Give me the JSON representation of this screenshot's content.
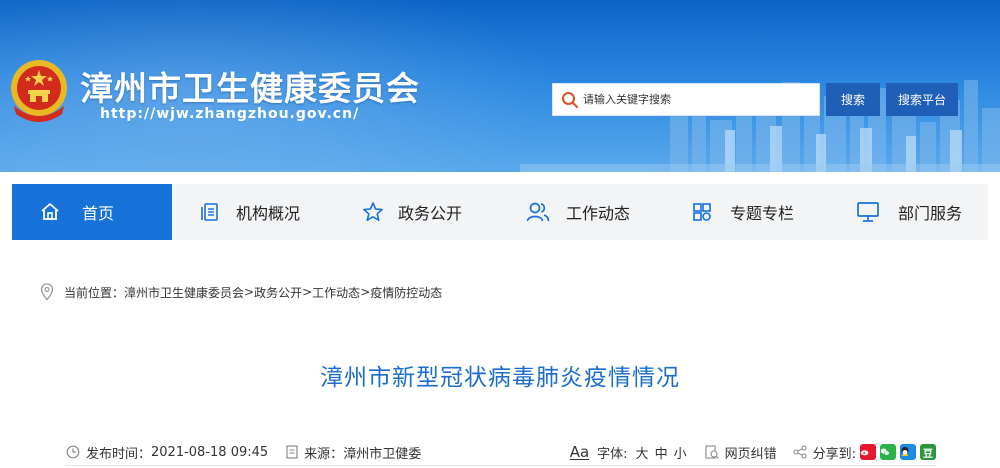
{
  "header": {
    "site_title": "漳州市卫生健康委员会",
    "site_url": "http://wjw.zhangzhou.gov.cn/",
    "emblem_icon": "national-emblem-icon",
    "search": {
      "placeholder": "请输入关键字搜索"
    },
    "search_button": "搜索",
    "platform_button": "搜索平台"
  },
  "nav": {
    "items": [
      {
        "label": "首页",
        "icon": "home-icon",
        "active": true
      },
      {
        "label": "机构概况",
        "icon": "document-icon",
        "active": false
      },
      {
        "label": "政务公开",
        "icon": "star-icon",
        "active": false
      },
      {
        "label": "工作动态",
        "icon": "people-icon",
        "active": false
      },
      {
        "label": "专题专栏",
        "icon": "grid-icon",
        "active": false
      },
      {
        "label": "部门服务",
        "icon": "monitor-icon",
        "active": false
      }
    ]
  },
  "breadcrumb": {
    "prefix": "当前位置：",
    "items": [
      "漳州市卫生健康委员会",
      "政务公开",
      "工作动态",
      "疫情防控动态"
    ],
    "separator": ">"
  },
  "article": {
    "title": "漳州市新型冠状病毒肺炎疫情情况",
    "publish_label": "发布时间：",
    "publish_time": "2021-08-18 09:45",
    "source_label": "来源：",
    "source": "漳州市卫健委",
    "font_label": "字体:",
    "font_icon": "Aa",
    "font_large": "大",
    "font_medium": "中",
    "font_small": "小",
    "error_label": "网页纠错",
    "share_label": "分享到:",
    "share_targets": [
      "weibo-icon",
      "wechat-icon",
      "qq-icon",
      "douban-icon"
    ],
    "share_douban_glyph": "豆"
  },
  "colors": {
    "banner_top": "#0b63c6",
    "nav_active": "#1671d9",
    "button_bg": "#1f5fb7",
    "title_blue": "#1a6dcc"
  }
}
